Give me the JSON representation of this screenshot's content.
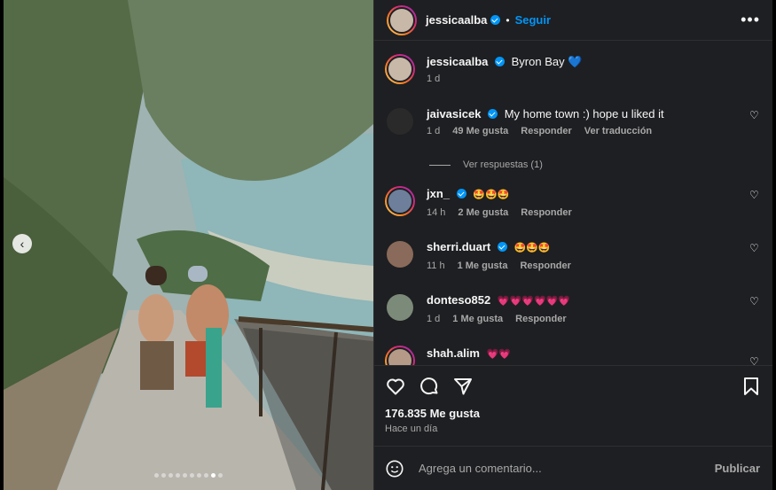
{
  "post": {
    "username": "jessicaalba",
    "follow_label": "Seguir",
    "more_label": "•••",
    "caption_user": "jessicaalba",
    "caption_text": "Byron Bay 💙",
    "caption_time": "1 d",
    "prev_label": "‹",
    "dots_total": 10,
    "dots_active": 9
  },
  "comments": [
    {
      "user": "jaivasicek",
      "verified": true,
      "text": "My home town :) hope u liked it",
      "time": "1 d",
      "likes": "49 Me gusta",
      "reply": "Responder",
      "translate": "Ver traducción"
    },
    {
      "user": "jxn_",
      "verified": true,
      "text": "🤩🤩🤩",
      "time": "14 h",
      "likes": "2 Me gusta",
      "reply": "Responder"
    },
    {
      "user": "sherri.duart",
      "verified": true,
      "text": "🤩🤩🤩",
      "time": "11 h",
      "likes": "1 Me gusta",
      "reply": "Responder"
    },
    {
      "user": "donteso852",
      "verified": false,
      "text": "💗💗💗💗💗💗",
      "time": "1 d",
      "likes": "1 Me gusta",
      "reply": "Responder"
    },
    {
      "user": "shah.alim",
      "verified": false,
      "text": "💗💗"
    }
  ],
  "view_replies": "Ver respuestas (1)",
  "footer": {
    "likes": "176.835 Me gusta",
    "when": "Hace un día",
    "comment_placeholder": "Agrega un comentario...",
    "publish_label": "Publicar"
  },
  "colors": {
    "panel_bg": "#1e1f22",
    "accent": "#0095f6",
    "muted": "#a8a8a8"
  }
}
